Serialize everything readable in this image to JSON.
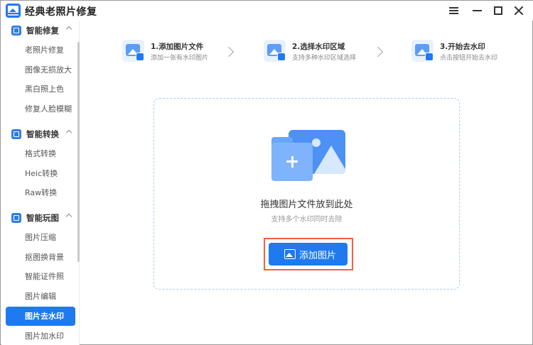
{
  "app": {
    "title": "经典老照片修复"
  },
  "sidebar": {
    "groups": [
      {
        "label": "智能修复",
        "items": [
          "老照片修复",
          "图像无损放大",
          "黑白照上色",
          "修复人脸模糊"
        ]
      },
      {
        "label": "智能转换",
        "items": [
          "格式转换",
          "Heic转换",
          "Raw转换"
        ]
      },
      {
        "label": "智能玩图",
        "items": [
          "图片压缩",
          "抠图换背景",
          "智能证件照",
          "图片编辑",
          "图片去水印",
          "图片加水印"
        ]
      }
    ],
    "active_item": "图片去水印"
  },
  "steps": [
    {
      "title": "1.添加图片文件",
      "desc": "添加一张有水印图片"
    },
    {
      "title": "2.选择水印区域",
      "desc": "支持多种水印区域选择"
    },
    {
      "title": "3.开始去水印",
      "desc": "点击按钮开始去水印"
    }
  ],
  "dropzone": {
    "title": "拖拽图片文件放到此处",
    "subtitle": "支持多个水印同时去除",
    "button_label": "添加图片"
  },
  "colors": {
    "accent": "#1f7af0",
    "highlight_outline": "#f0643a"
  }
}
